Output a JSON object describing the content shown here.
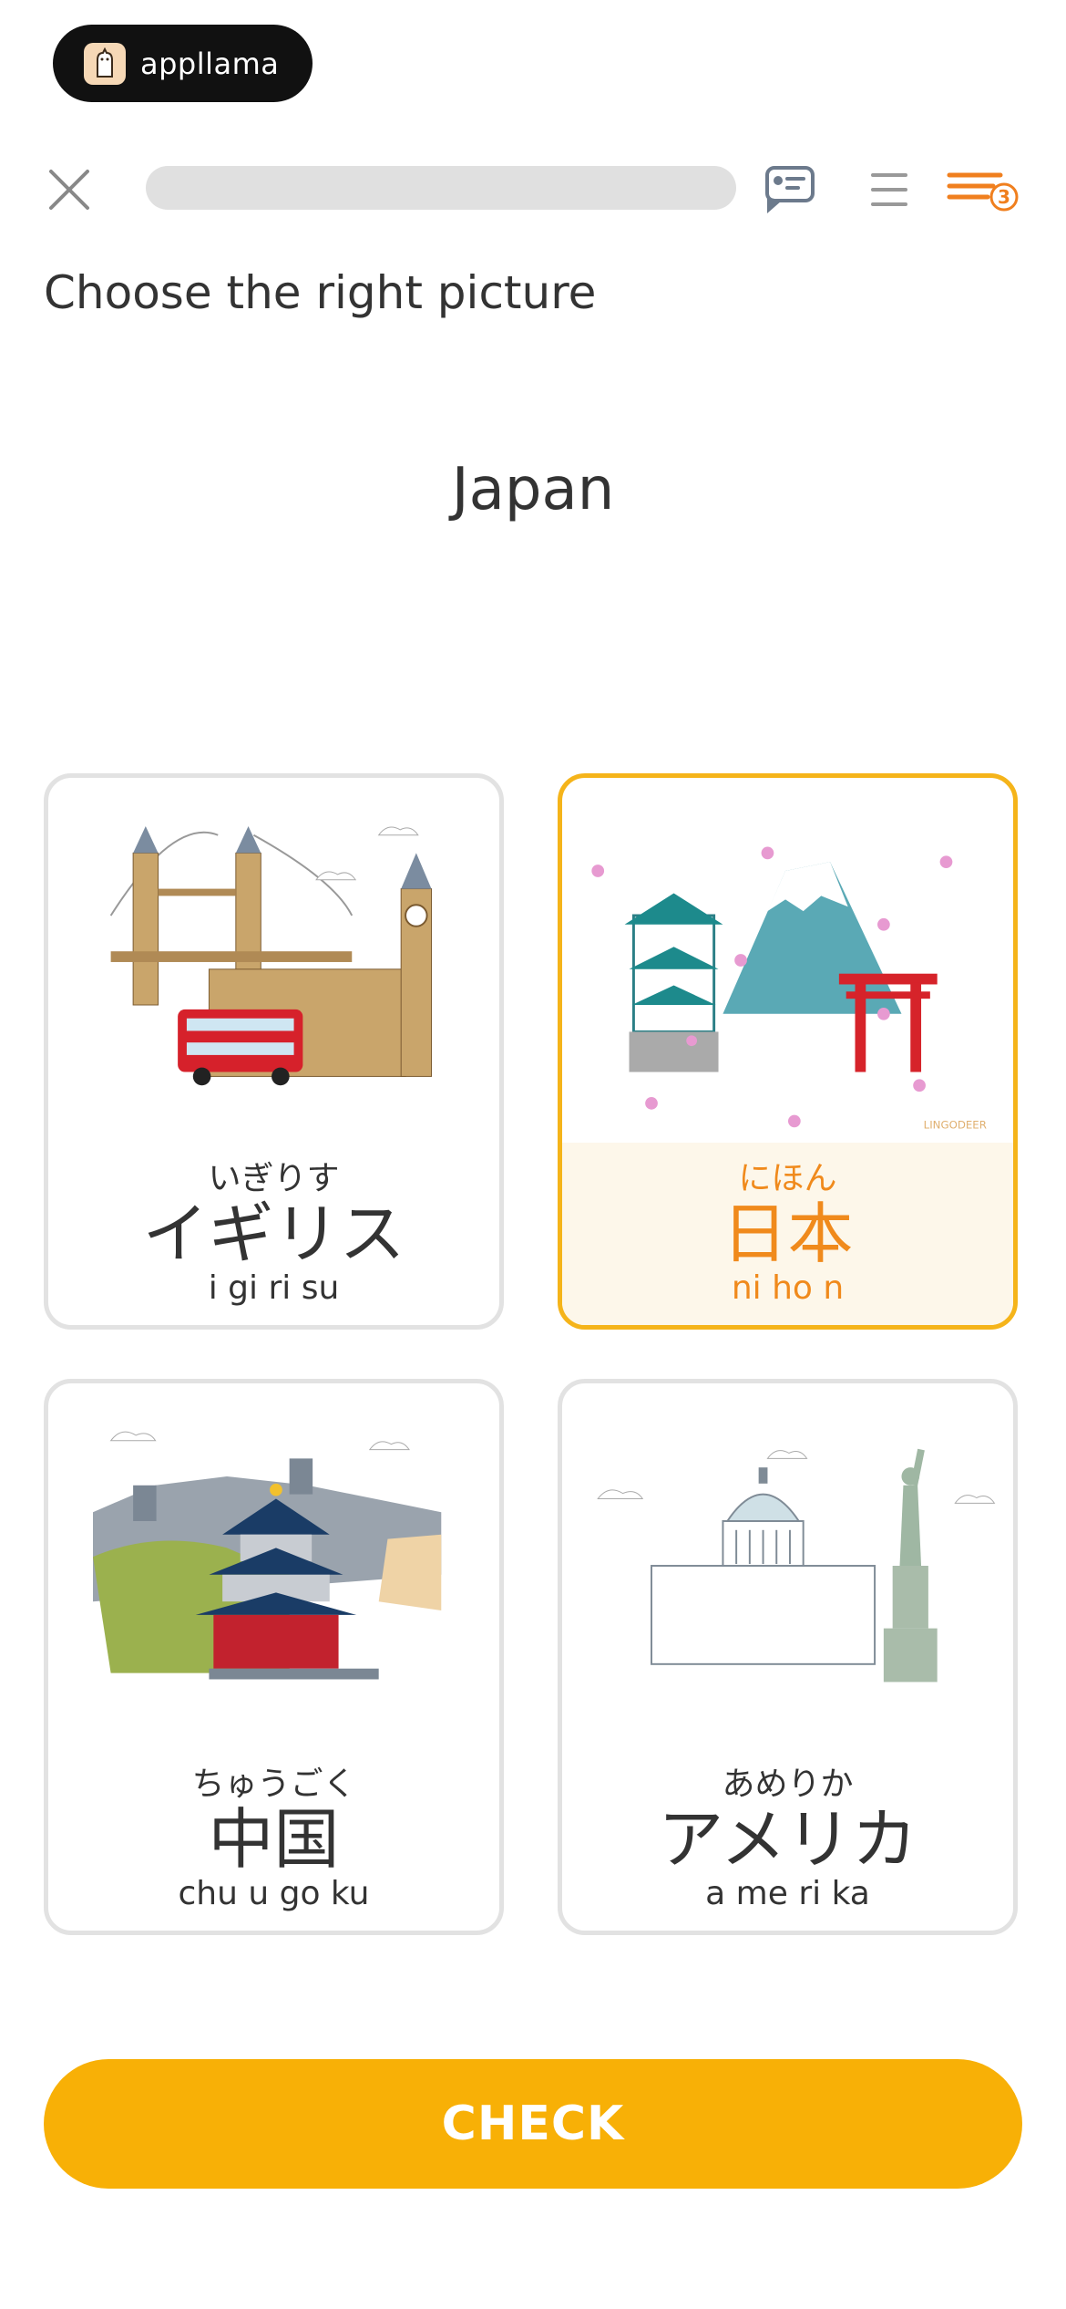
{
  "brand": {
    "name": "appllama"
  },
  "topbar": {
    "progress_fraction": 0.0
  },
  "instruction": "Choose the right picture",
  "prompt_word": "Japan",
  "options": [
    {
      "kana": "いぎりす",
      "word": "イギリス",
      "romaji": "i gi ri su",
      "selected": false
    },
    {
      "kana": "にほん",
      "word": "日本",
      "romaji": "ni ho n",
      "selected": true,
      "watermark": "LINGODEER"
    },
    {
      "kana": "ちゅうごく",
      "word": "中国",
      "romaji": "chu u go ku",
      "selected": false
    },
    {
      "kana": "あめりか",
      "word": "アメリカ",
      "romaji": "a me ri ka",
      "selected": false
    }
  ],
  "check_button": {
    "label": "CHECK"
  },
  "colors": {
    "accent": "#f8b006",
    "selected_border": "#f5b41a",
    "selected_text": "#f08a1c",
    "selected_bg": "#fdf7ea"
  },
  "queue_badge_count": "3"
}
